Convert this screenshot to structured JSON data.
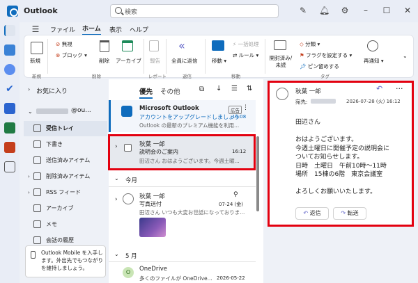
{
  "app": {
    "title": "Outlook"
  },
  "search": {
    "placeholder": "検索"
  },
  "menu": {
    "items": [
      "ファイル",
      "ホーム",
      "表示",
      "ヘルプ"
    ],
    "active": "ホーム"
  },
  "ribbon": {
    "new_label": "新規",
    "group_new": "新規",
    "ignore": "無視",
    "block": "ブロック",
    "delete": "削除",
    "archive": "アーカイブ",
    "group_delete": "削除",
    "report": "報告",
    "group_report": "レポート",
    "reply_all": "全員に返信",
    "group_reply": "返信",
    "move": "移動",
    "bulk": "一括処理",
    "rules": "ルール",
    "group_move": "移動",
    "read_unread": "開封済み/未読",
    "category": "分類",
    "flag": "フラグを設定する",
    "pin": "ピン留めする",
    "group_tags": "タグ",
    "snooze": "再通知"
  },
  "folders": {
    "favorites": "お気に入り",
    "account": "@ou...",
    "items": [
      "受信トレイ",
      "下書き",
      "送信済みアイテム",
      "削除済みアイテム",
      "RSS フィード",
      "アーカイブ",
      "メモ",
      "会話の履歴"
    ],
    "promo": "Outlook Mobile を入手します。外出先でもつながりを維持しましょう。"
  },
  "list": {
    "tab_focused": "優先",
    "tab_other": "その他",
    "ad": {
      "sender": "Microsoft Outlook",
      "badge": "広告",
      "subject": "アカウントをアップグレードしましょう",
      "time": "16:08",
      "preview": "Outlook の最新のプレミアム機能を利用..."
    },
    "selected": {
      "sender": "秋葉 一郎",
      "subject": "説明会のご案内",
      "time": "16:12",
      "preview": "田辺さん おはようございます。今週土曜..."
    },
    "section_month": "今月",
    "photo": {
      "sender": "秋葉 一郎",
      "subject": "写真送付",
      "date": "07-24 (金)",
      "preview": "田辺さん いつも大変お世話になっておりま..."
    },
    "section_may": "5 月",
    "onedrive": {
      "sender": "OneDrive",
      "preview": "多くのファイルが OneDrive...",
      "date": "2026-05-22"
    }
  },
  "reading": {
    "sender": "秋葉 一郎",
    "to_label": "宛先:",
    "date": "2026-07-28 (火) 16:12",
    "body": [
      "田辺さん",
      "",
      "おはようございます。",
      "今週土曜日に開催予定の説明会に",
      "ついてお知らせします。",
      "日時　土曜日　午前10時〜11時",
      "場所　15棟の6階　東京会議室",
      "",
      "よろしくお願いいたします。"
    ],
    "reply": "返信",
    "forward": "転送"
  },
  "colors": {
    "accent": "#0f6cbd",
    "highlight": "#e3000f"
  }
}
